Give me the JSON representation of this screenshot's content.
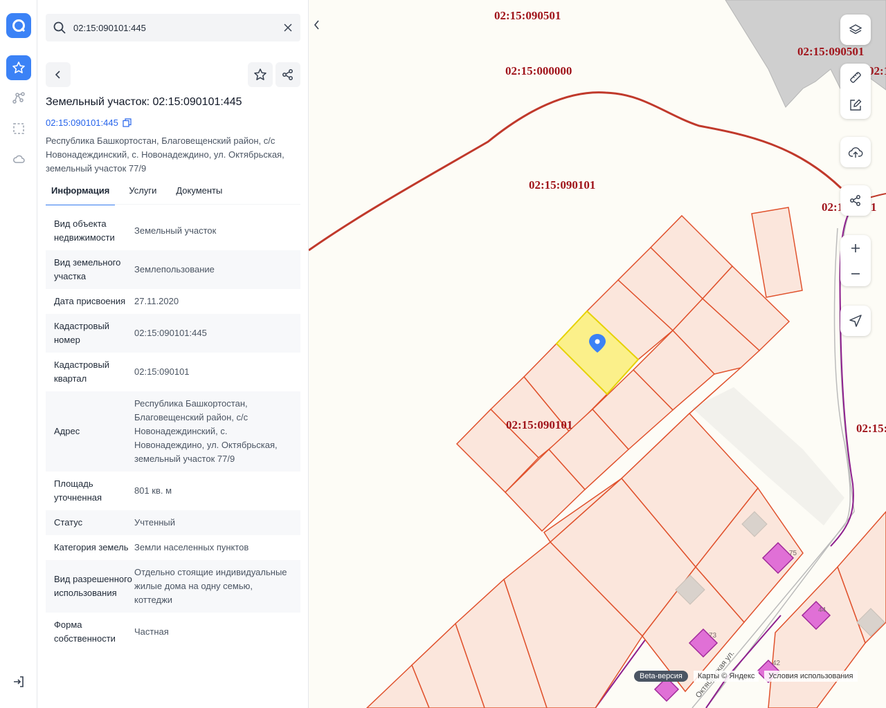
{
  "search": {
    "value": "02:15:090101:445"
  },
  "panel": {
    "title": "Земельный участок: 02:15:090101:445",
    "cad_link": "02:15:090101:445",
    "address": "Республика Башкортостан, Благовещенский район, с/с Новонадеждинский, с. Новонадеждино, ул. Октябрьская, земельный участок 77/9",
    "tabs": [
      "Информация",
      "Услуги",
      "Документы"
    ],
    "rows": [
      {
        "k": "Вид объекта недвижимости",
        "v": "Земельный участок"
      },
      {
        "k": "Вид земельного участка",
        "v": "Землепользование"
      },
      {
        "k": "Дата присвоения",
        "v": "27.11.2020"
      },
      {
        "k": "Кадастровый номер",
        "v": "02:15:090101:445"
      },
      {
        "k": "Кадастровый квартал",
        "v": "02:15:090101"
      },
      {
        "k": "Адрес",
        "v": "Республика Башкортостан, Благовещенский район, с/с Новонадеждинский, с. Новонадеждино, ул. Октябрьская, земельный участок 77/9"
      },
      {
        "k": "Площадь уточненная",
        "v": "801 кв. м"
      },
      {
        "k": "Статус",
        "v": "Учтенный"
      },
      {
        "k": "Категория земель",
        "v": "Земли населенных пунктов"
      },
      {
        "k": "Вид разрешенного использования",
        "v": "Отдельно стоящие индивидуальные жилые дома на одну семью, коттеджи"
      },
      {
        "k": "Форма собственности",
        "v": "Частная"
      }
    ]
  },
  "map": {
    "labels": {
      "l1": "02:15:090501",
      "l2": "02:15:090501",
      "l3": "02:15:000000",
      "l4": "02:15:090101",
      "l5": "02:15:090101",
      "l6": "02:15:0901",
      "l7": "02:15:",
      "l8": "02:1"
    },
    "house_numbers": {
      "h1": "75",
      "h2": "73",
      "h3": "44",
      "h4": "42"
    },
    "street": "Октябрьская ул.",
    "beta": "Beta-версия",
    "copyright": "Карты © Яндекс",
    "terms": "Условия использования"
  },
  "colors": {
    "accent": "#3b82f6",
    "parcel_border": "#e0522d",
    "parcel_fill": "#fbe6dc",
    "selected_fill": "#fbf08a",
    "quarter_line": "#c0392b"
  }
}
